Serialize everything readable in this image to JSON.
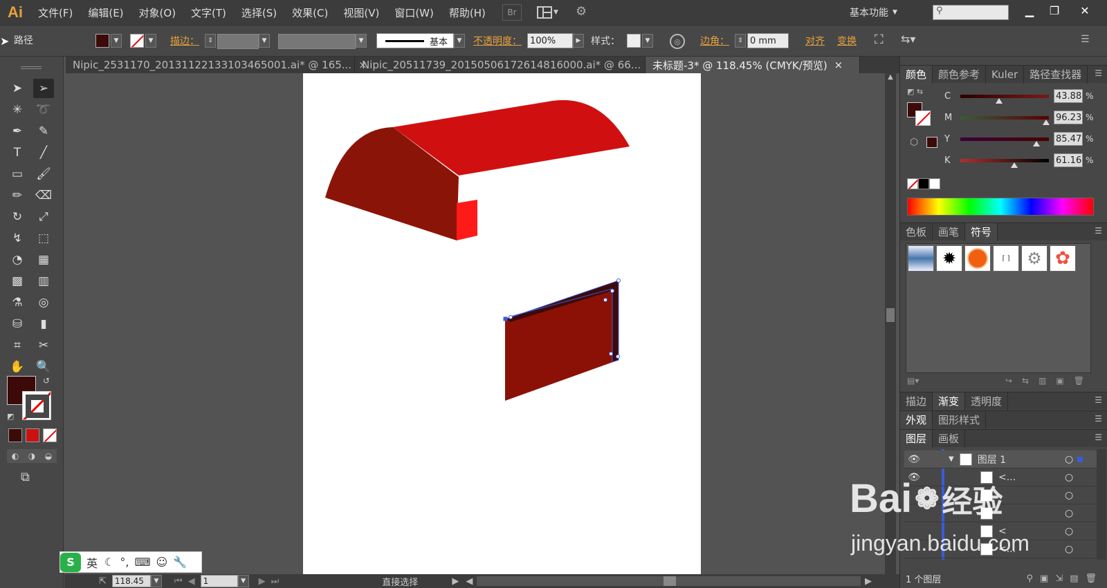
{
  "app": {
    "logo": "Ai",
    "workspace": "基本功能",
    "bridge": "Br"
  },
  "menu": [
    "文件(F)",
    "编辑(E)",
    "对象(O)",
    "文字(T)",
    "选择(S)",
    "效果(C)",
    "视图(V)",
    "窗口(W)",
    "帮助(H)"
  ],
  "control": {
    "object_type": "路径",
    "fill_color": "#3d0a0a",
    "stroke_label": "描边：",
    "stroke_style": "基本",
    "opacity_label": "不透明度：",
    "opacity_value": "100%",
    "style_label": "样式：",
    "corner_label": "边角：",
    "corner_value": "0 mm",
    "align": "对齐",
    "transform": "变换"
  },
  "tabs": [
    {
      "label": "Nipic_2531170_20131122133103465001.ai* @ 165...",
      "active": false
    },
    {
      "label": "Nipic_20511739_20150506172614816000.ai* @ 66...",
      "active": false
    },
    {
      "label": "未标题-3* @ 118.45% (CMYK/预览)",
      "active": true
    }
  ],
  "status": {
    "zoom": "118.45",
    "page": "1",
    "tool": "直接选择"
  },
  "color_panel": {
    "tabs": [
      "颜色",
      "颜色参考",
      "Kuler",
      "路径查找器"
    ],
    "channels": [
      {
        "name": "C",
        "value": "43.88",
        "pct": 0.44,
        "grad": [
          "#3a0000",
          "#3d0a0a",
          "#800000"
        ]
      },
      {
        "name": "M",
        "value": "96.23",
        "pct": 0.96,
        "grad": [
          "#2a4a2a",
          "#3d0a0a",
          "#660000"
        ]
      },
      {
        "name": "Y",
        "value": "85.47",
        "pct": 0.85,
        "grad": [
          "#3a003a",
          "#3d0a0a",
          "#550000"
        ]
      },
      {
        "name": "K",
        "value": "61.16",
        "pct": 0.61,
        "grad": [
          "#aa2a2a",
          "#3d0a0a",
          "#000000"
        ]
      }
    ],
    "percent": "%"
  },
  "swatch_panel": {
    "tabs": [
      "色板",
      "画笔",
      "符号"
    ]
  },
  "gradient_panel": {
    "tabs": [
      "描边",
      "渐变",
      "透明度"
    ]
  },
  "appearance_panel": {
    "tabs": [
      "外观",
      "图形样式"
    ]
  },
  "layers_panel": {
    "tabs": [
      "图层",
      "画板"
    ],
    "rows": [
      {
        "name": "图层 1"
      },
      {
        "name": "<..."
      },
      {
        "name": ""
      },
      {
        "name": ""
      },
      {
        "name": "<"
      },
      {
        "name": "<..."
      }
    ],
    "footer": "1 个图层"
  },
  "watermark": {
    "brand": "Bai",
    "brand2": "经验",
    "url": "jingyan.baidu.com"
  },
  "ime": {
    "lang": "英"
  },
  "colors": {
    "accent": "#e8a13c",
    "red_top": "#d01010",
    "red_dark": "#8b1408",
    "panel_red": "#8b1106",
    "selection": "#3b5bdb"
  }
}
